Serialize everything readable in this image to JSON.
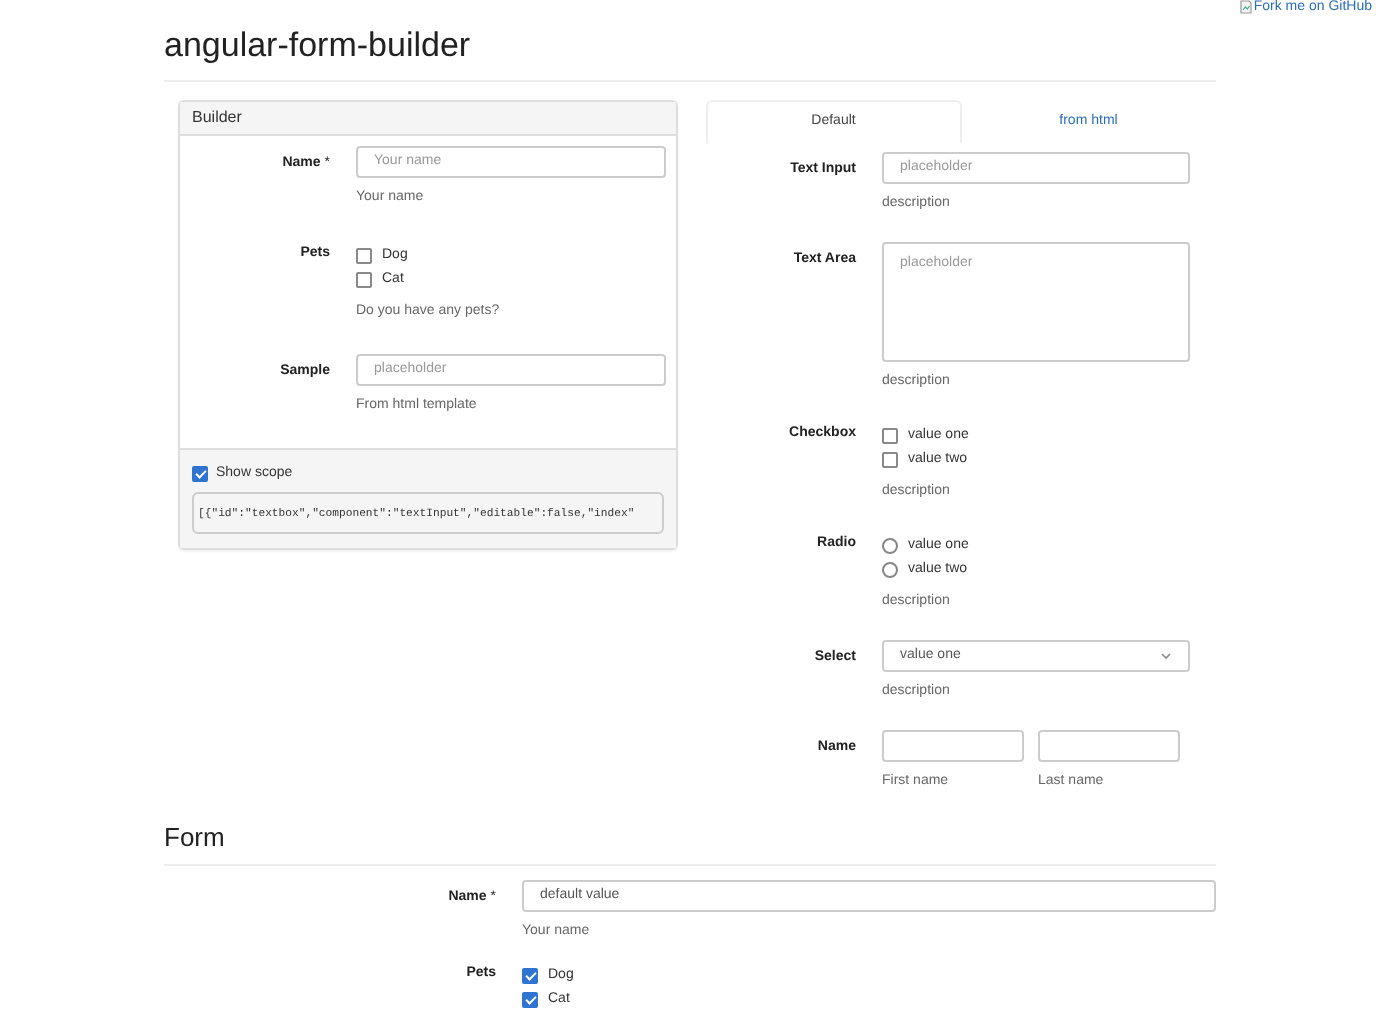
{
  "page": {
    "title": "angular-form-builder",
    "fork_link": "Fork me on GitHub"
  },
  "builder": {
    "title": "Builder",
    "fields": [
      {
        "kind": "text",
        "label": "Name",
        "required_mark": "*",
        "placeholder": "Your name",
        "description": "Your name"
      },
      {
        "kind": "checkbox",
        "label": "Pets",
        "options": [
          {
            "label": "Dog",
            "checked": false
          },
          {
            "label": "Cat",
            "checked": false
          }
        ],
        "description": "Do you have any pets?"
      },
      {
        "kind": "text",
        "label": "Sample",
        "placeholder": "placeholder",
        "description": "From html template"
      }
    ],
    "show_scope": {
      "label": "Show scope",
      "checked": true
    },
    "scope_text": "[{\"id\":\"textbox\",\"component\":\"textInput\",\"editable\":false,\"index\""
  },
  "palette": {
    "tabs": [
      {
        "label": "Default",
        "selected": true
      },
      {
        "label": "from html",
        "selected": false
      }
    ],
    "fields": [
      {
        "kind": "text",
        "label": "Text Input",
        "placeholder": "placeholder",
        "description": "description"
      },
      {
        "kind": "textarea",
        "label": "Text Area",
        "placeholder": "placeholder",
        "description": "description"
      },
      {
        "kind": "checkbox",
        "label": "Checkbox",
        "options": [
          {
            "label": "value one",
            "checked": false
          },
          {
            "label": "value two",
            "checked": false
          }
        ],
        "description": "description"
      },
      {
        "kind": "radio",
        "label": "Radio",
        "options": [
          {
            "label": "value one",
            "selected": false
          },
          {
            "label": "value two",
            "selected": false
          }
        ],
        "description": "description"
      },
      {
        "kind": "select",
        "label": "Select",
        "value": "value one",
        "description": "description"
      },
      {
        "kind": "name",
        "label": "Name",
        "parts": [
          {
            "description": "First name"
          },
          {
            "description": "Last name"
          }
        ]
      }
    ]
  },
  "form": {
    "title": "Form",
    "fields": [
      {
        "kind": "text",
        "label": "Name",
        "required_mark": "*",
        "value": "default value",
        "description": "Your name"
      },
      {
        "kind": "checkbox",
        "label": "Pets",
        "options": [
          {
            "label": "Dog",
            "checked": true
          },
          {
            "label": "Cat",
            "checked": true
          }
        ]
      }
    ]
  }
}
